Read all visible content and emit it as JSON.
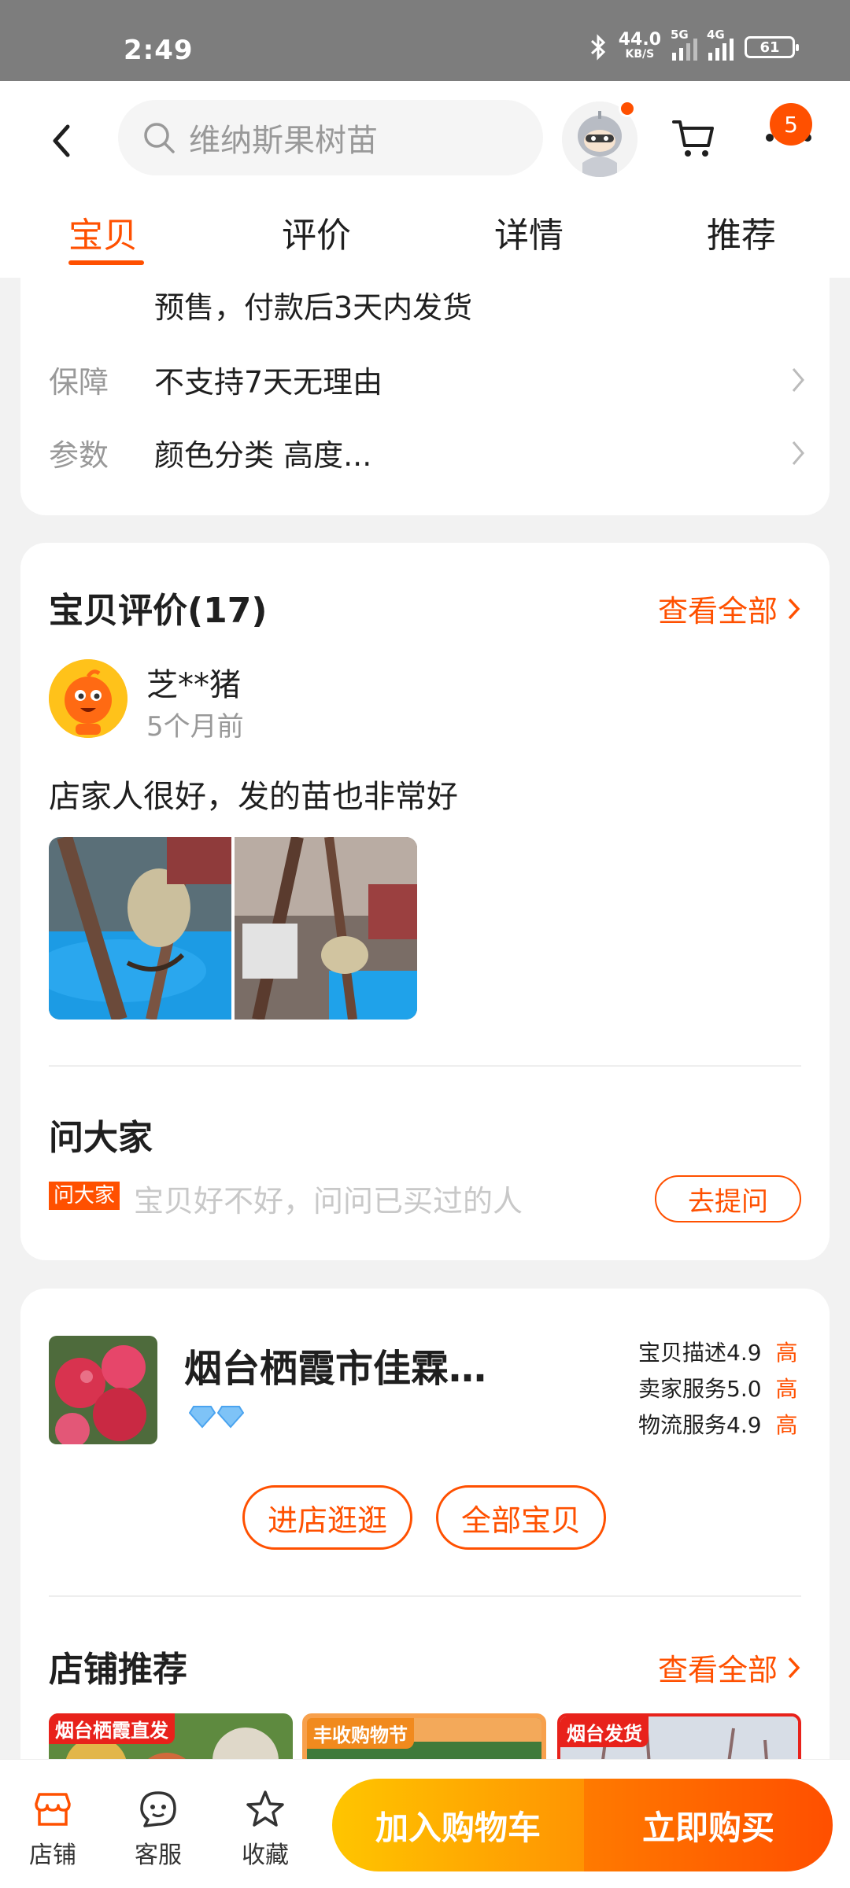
{
  "status_bar": {
    "time": "2:49",
    "net_speed_value": "44.0",
    "net_speed_unit": "KB/S",
    "signal1": "5G",
    "signal2": "4G",
    "battery": "61"
  },
  "header": {
    "search_text": "维纳斯果树苗",
    "cart_badge": "5"
  },
  "tabs": [
    "宝贝",
    "评价",
    "详情",
    "推荐"
  ],
  "info": {
    "shipping_text": "预售，付款后3天内发货",
    "guarantee_key": "保障",
    "guarantee_value": "不支持7天无理由",
    "params_key": "参数",
    "params_value": "颜色分类 高度..."
  },
  "reviews": {
    "title": "宝贝评价(17)",
    "see_all": "查看全部",
    "user": "芝**猪",
    "time": "5个月前",
    "text": "店家人很好，发的苗也非常好"
  },
  "ask": {
    "title": "问大家",
    "tag": "问大家",
    "placeholder": "宝贝好不好，问问已买过的人",
    "button": "去提问"
  },
  "shop": {
    "name": "烟台栖霞市佳霖果树苗…",
    "scores": [
      {
        "label": "宝贝描述",
        "value": "4.9",
        "level": "高"
      },
      {
        "label": "卖家服务",
        "value": "5.0",
        "level": "高"
      },
      {
        "label": "物流服务",
        "value": "4.9",
        "level": "高"
      }
    ],
    "btn_enter": "进店逛逛",
    "btn_all": "全部宝贝",
    "rec_title": "店铺推荐",
    "rec_see_all": "查看全部",
    "thumb_tags": [
      "烟台栖霞直发",
      "丰收购物节",
      "烟台发货"
    ]
  },
  "bottom_bar": {
    "shop": "店铺",
    "service": "客服",
    "favorite": "收藏",
    "add_cart": "加入购物车",
    "buy_now": "立即购买"
  },
  "colors": {
    "accent": "#ff5000",
    "cart_button": "#ffb000",
    "status_bar": "#7d7d7d"
  }
}
